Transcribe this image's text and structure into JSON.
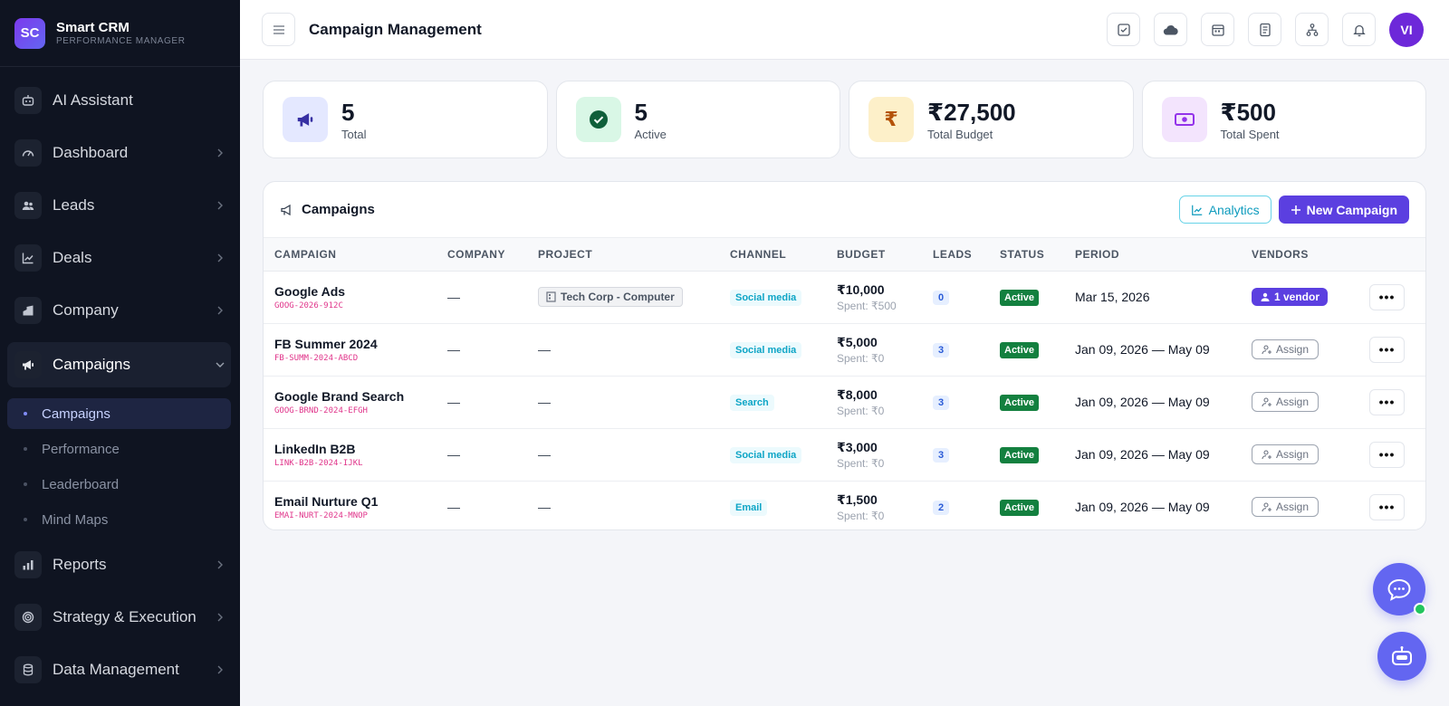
{
  "brand": {
    "initials": "SC",
    "name": "Smart CRM",
    "subtitle": "PERFORMANCE MANAGER"
  },
  "sidebar": {
    "items": [
      {
        "label": "AI Assistant",
        "icon": "robot-icon"
      },
      {
        "label": "Dashboard",
        "icon": "gauge-icon"
      },
      {
        "label": "Leads",
        "icon": "users-icon"
      },
      {
        "label": "Deals",
        "icon": "trend-chart-icon"
      },
      {
        "label": "Company",
        "icon": "building-icon"
      },
      {
        "label": "Campaigns",
        "icon": "megaphone-icon",
        "expanded": true
      }
    ],
    "sub_items": [
      {
        "label": "Campaigns",
        "active": true
      },
      {
        "label": "Performance"
      },
      {
        "label": "Leaderboard"
      },
      {
        "label": "Mind Maps"
      }
    ],
    "items_after": [
      {
        "label": "Reports",
        "icon": "bar-chart-icon"
      },
      {
        "label": "Strategy & Execution",
        "icon": "target-icon"
      },
      {
        "label": "Data Management",
        "icon": "database-icon"
      }
    ]
  },
  "header": {
    "title": "Campaign Management",
    "avatar": "VI"
  },
  "stats": [
    {
      "value": "5",
      "label": "Total",
      "icon": "megaphone-icon",
      "bg": "#e4e8ff",
      "fg": "#4338ca"
    },
    {
      "value": "5",
      "label": "Active",
      "icon": "check-circle-icon",
      "bg": "#d9f7e6",
      "fg": "#0f7a43"
    },
    {
      "value": "₹27,500",
      "label": "Total Budget",
      "icon": "rupee-icon",
      "bg": "#fdf0c9",
      "fg": "#b45309"
    },
    {
      "value": "₹500",
      "label": "Total Spent",
      "icon": "money-icon",
      "bg": "#f3e4fd",
      "fg": "#9333ea"
    }
  ],
  "panel": {
    "title": "Campaigns",
    "analytics_label": "Analytics",
    "new_label": "New Campaign",
    "columns": [
      "CAMPAIGN",
      "COMPANY",
      "PROJECT",
      "CHANNEL",
      "BUDGET",
      "LEADS",
      "STATUS",
      "PERIOD",
      "VENDORS"
    ],
    "rows": [
      {
        "name": "Google Ads",
        "code": "GOOG-2026-912C",
        "company": "—",
        "project": "Tech Corp - Computer",
        "channel": "Social media",
        "budget": "₹10,000",
        "spent": "Spent: ₹500",
        "leads": "0",
        "status": "Active",
        "period": "Mar 15, 2026",
        "vendor": "1 vendor",
        "vendor_assigned": true
      },
      {
        "name": "FB Summer 2024",
        "code": "FB-SUMM-2024-ABCD",
        "company": "—",
        "project": "—",
        "channel": "Social media",
        "budget": "₹5,000",
        "spent": "Spent: ₹0",
        "leads": "3",
        "status": "Active",
        "period": "Jan 09, 2026 — May 09",
        "vendor": "Assign",
        "vendor_assigned": false
      },
      {
        "name": "Google Brand Search",
        "code": "GOOG-BRND-2024-EFGH",
        "company": "—",
        "project": "—",
        "channel": "Search",
        "budget": "₹8,000",
        "spent": "Spent: ₹0",
        "leads": "3",
        "status": "Active",
        "period": "Jan 09, 2026 — May 09",
        "vendor": "Assign",
        "vendor_assigned": false
      },
      {
        "name": "LinkedIn B2B",
        "code": "LINK-B2B-2024-IJKL",
        "company": "—",
        "project": "—",
        "channel": "Social media",
        "budget": "₹3,000",
        "spent": "Spent: ₹0",
        "leads": "3",
        "status": "Active",
        "period": "Jan 09, 2026 — May 09",
        "vendor": "Assign",
        "vendor_assigned": false
      },
      {
        "name": "Email Nurture Q1",
        "code": "EMAI-NURT-2024-MNOP",
        "company": "—",
        "project": "—",
        "channel": "Email",
        "budget": "₹1,500",
        "spent": "Spent: ₹0",
        "leads": "2",
        "status": "Active",
        "period": "Jan 09, 2026 — May 09",
        "vendor": "Assign",
        "vendor_assigned": false
      }
    ],
    "more_label": "•••"
  },
  "colors": {
    "accent": "#5b3fe0",
    "sidebar_bg": "#0f1421",
    "status_active": "#13803f"
  }
}
